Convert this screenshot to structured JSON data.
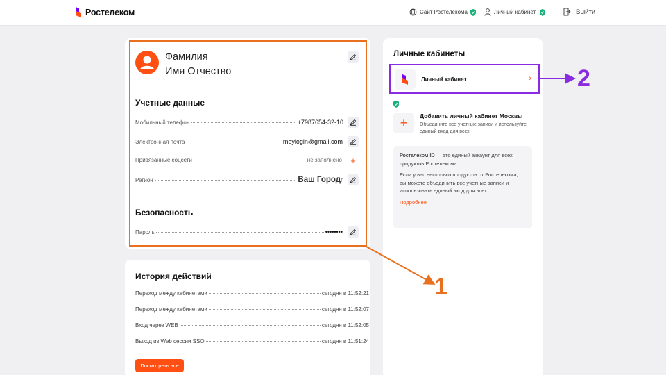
{
  "header": {
    "brand": "Ростелеком",
    "site_link": "Сайт Ростелекома",
    "account_link": "Личный кабинет",
    "logout": "Выйти"
  },
  "profile": {
    "last_name": "Фамилия",
    "first_middle_name": "Имя Отчество",
    "credentials_title": "Учетные данные",
    "rows": [
      {
        "label": "Мобильный телефон",
        "value": "+7987654-32-10"
      },
      {
        "label": "Электронная почта",
        "value": "moylogin@gmail.com"
      },
      {
        "label": "Привязанные соцсети",
        "value": "не заполнено"
      },
      {
        "label": "Регион",
        "value": "Ваш Город"
      }
    ],
    "region_suffix": "г",
    "security_title": "Безопасность",
    "password_label": "Пароль",
    "password_value": "••••••••"
  },
  "history": {
    "title": "История действий",
    "rows": [
      {
        "action": "Переход между кабинетами",
        "time": "сегодня в 11:52:21"
      },
      {
        "action": "Переход между кабинетами",
        "time": "сегодня в 11:52:07"
      },
      {
        "action": "Вход через WEB",
        "time": "сегодня в 11:52:05"
      },
      {
        "action": "Выход из Web сессии SSO",
        "time": "сегодня в 11:51:24"
      }
    ],
    "see_all": "Посмотреть все"
  },
  "cabinets": {
    "title": "Личные кабинеты",
    "item_label": "Личный кабинет",
    "add_title": "Добавить личный кабинет Москвы",
    "add_desc": "Объедините все учетные записи и используйте единый вход для всех",
    "info_p1_strong": "Ростелеком ID",
    "info_p1_rest": " — это единый аккаунт для всех продуктов Ростелекома.",
    "info_p2": "Если у вас несколько продуктов от Ростелекома, вы можете объединить все учетные записи и использовать единый вход для всех.",
    "info_link": "Подробнее"
  },
  "callouts": {
    "one": "1",
    "two": "2"
  },
  "colors": {
    "brand_orange": "#ff4f12",
    "brand_purple": "#7700ff",
    "callout_orange": "#e8701f",
    "callout_purple": "#8a2be2"
  }
}
